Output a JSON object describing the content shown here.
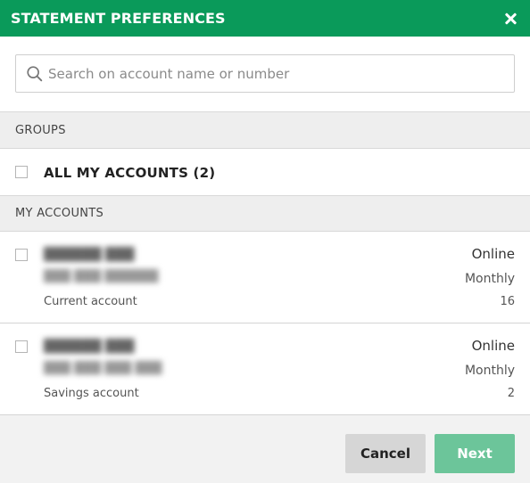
{
  "dialog": {
    "title": "STATEMENT PREFERENCES",
    "close_icon": "close-icon"
  },
  "search": {
    "placeholder": "Search on account name or number",
    "value": "",
    "icon": "search-icon"
  },
  "groups": {
    "header": "GROUPS",
    "items": [
      {
        "label": "ALL MY ACCOUNTS (2)",
        "checked": false
      }
    ]
  },
  "accounts": {
    "header": "MY ACCOUNTS",
    "items": [
      {
        "name_redacted": "██████ ███",
        "number_redacted": "███ ███ ██████",
        "type": "Current account",
        "delivery": "Online",
        "frequency": "Monthly",
        "count": "16",
        "checked": false
      },
      {
        "name_redacted": "██████ ███",
        "number_redacted": "███ ███ ███ ███",
        "type": "Savings account",
        "delivery": "Online",
        "frequency": "Monthly",
        "count": "2",
        "checked": false
      }
    ]
  },
  "footer": {
    "cancel_label": "Cancel",
    "next_label": "Next"
  },
  "colors": {
    "brand": "#0a9a5a",
    "next_disabled": "#6cc59a",
    "cancel": "#d6d6d6"
  }
}
